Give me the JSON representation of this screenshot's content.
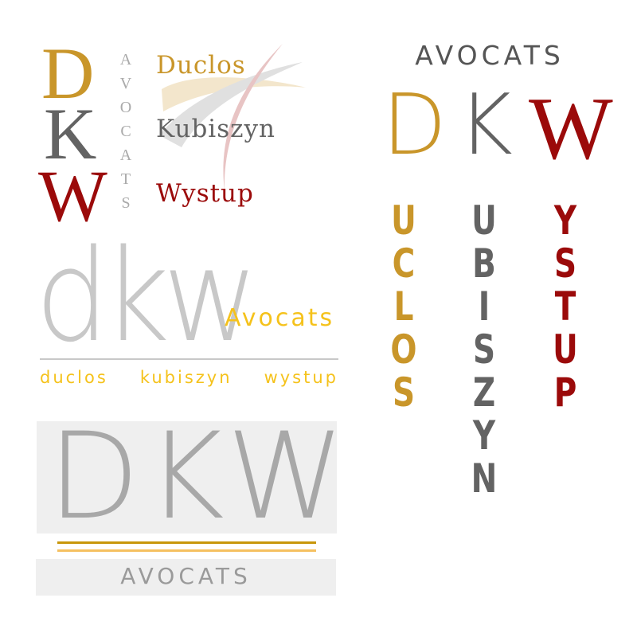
{
  "logo1": {
    "initials": [
      "D",
      "K",
      "W"
    ],
    "vertical_word": [
      "A",
      "V",
      "O",
      "C",
      "A",
      "T",
      "S"
    ],
    "names": [
      "Duclos",
      "Kubiszyn",
      "Wystup"
    ]
  },
  "logo2": {
    "mark": "dkw",
    "tagline": "Avocats",
    "names": [
      "duclos",
      "kubiszyn",
      "wystup"
    ]
  },
  "logo3": {
    "mark": "DKW",
    "word": "AVOCATS"
  },
  "logo4": {
    "word": "AVOCATS",
    "initials": [
      "D",
      "K",
      "W"
    ],
    "columns": [
      [
        "U",
        "C",
        "L",
        "O",
        "S"
      ],
      [
        "U",
        "B",
        "I",
        "S",
        "Z",
        "Y",
        "N"
      ],
      [
        "Y",
        "S",
        "T",
        "U",
        "P"
      ]
    ]
  },
  "colors": {
    "gold": "#c9962a",
    "gray": "#636363",
    "red": "#9b0a0a",
    "light_gray": "#c8c8c8",
    "yellow": "#f5c21b",
    "panel": "#efefef"
  }
}
